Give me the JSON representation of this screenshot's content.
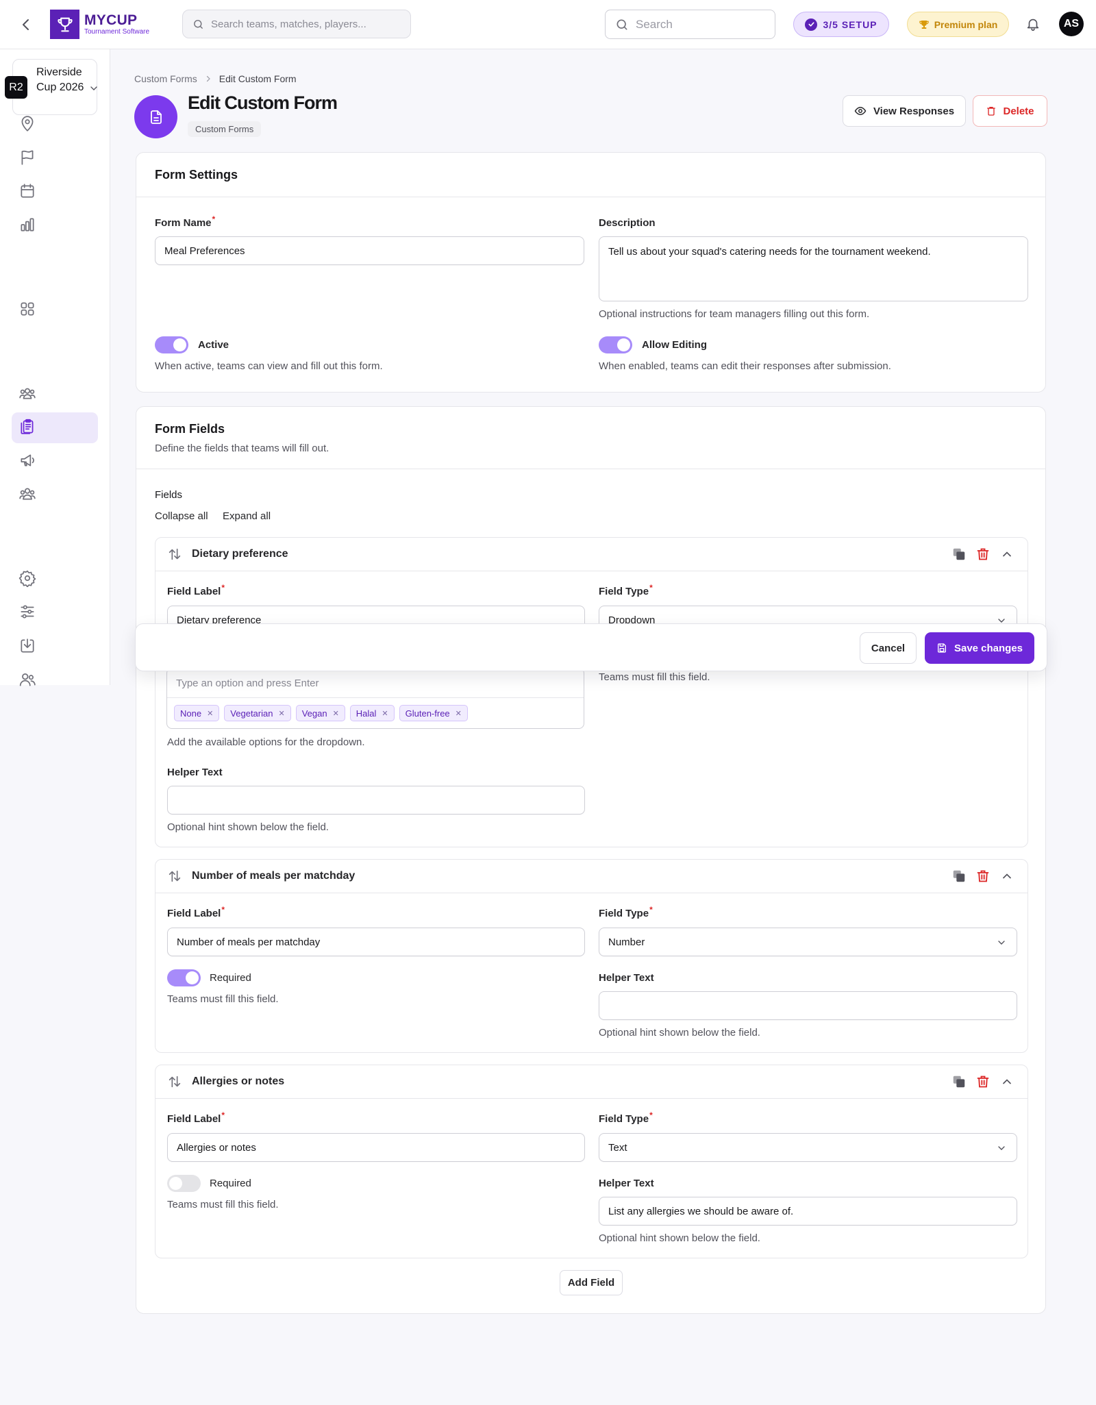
{
  "app": {
    "logo_title": "MYCUP",
    "logo_subtitle": "Tournament Software",
    "search_placeholder": "Search teams, matches, players...",
    "search2_placeholder": "Search",
    "setup_label": "3/5  SETUP",
    "premium_label": "Premium plan",
    "avatar_initials": "AS"
  },
  "sidebar": {
    "tournament_badge": "R2",
    "tournament_name": "Riverside Cup 2026",
    "items": [
      {
        "icon": "map-pin-icon"
      },
      {
        "icon": "flag-icon"
      },
      {
        "icon": "calendar-icon"
      },
      {
        "icon": "bar-chart-icon"
      },
      {
        "icon": "grid-icon"
      },
      {
        "icon": "teams-icon"
      },
      {
        "icon": "clipboard-icon",
        "active": true
      },
      {
        "icon": "megaphone-icon"
      },
      {
        "icon": "users-group-icon"
      },
      {
        "icon": "settings-icon"
      },
      {
        "icon": "sliders-icon"
      },
      {
        "icon": "download-icon"
      },
      {
        "icon": "user-icon"
      }
    ]
  },
  "breadcrumb": {
    "parent": "Custom Forms",
    "current": "Edit Custom Form"
  },
  "page": {
    "title": "Edit Custom Form",
    "tag": "Custom Forms",
    "view_responses": "View Responses",
    "delete": "Delete"
  },
  "form_settings": {
    "title": "Form Settings",
    "name_label": "Form Name",
    "name_value": "Meal Preferences",
    "description_label": "Description",
    "description_value": "Tell us about your squad's catering needs for the tournament weekend.",
    "description_help": "Optional instructions for team managers filling out this form.",
    "active_label": "Active",
    "active_help": "When active, teams can view and fill out this form.",
    "active_on": true,
    "editing_label": "Allow Editing",
    "editing_help": "When enabled, teams can edit their responses after submission.",
    "editing_on": true
  },
  "form_fields": {
    "title": "Form Fields",
    "subtitle": "Define the fields that teams will fill out.",
    "fields_label": "Fields",
    "collapse_all": "Collapse all",
    "expand_all": "Expand all",
    "add_field": "Add Field",
    "items": [
      {
        "title": "Dietary preference",
        "label_caption": "Field Label",
        "label_value": "Dietary preference",
        "type_caption": "Field Type",
        "type_value": "Dropdown",
        "options_placeholder": "Type an option and press Enter",
        "options": [
          "None",
          "Vegetarian",
          "Vegan",
          "Halal",
          "Gluten-free"
        ],
        "options_help": "Add the available options for the dropdown.",
        "required_help": "Teams must fill this field.",
        "helper_caption": "Helper Text",
        "helper_value": "",
        "helper_help": "Optional hint shown below the field."
      },
      {
        "title": "Number of meals per matchday",
        "label_caption": "Field Label",
        "label_value": "Number of meals per matchday",
        "type_caption": "Field Type",
        "type_value": "Number",
        "required_label": "Required",
        "required_on": true,
        "required_help": "Teams must fill this field.",
        "helper_caption": "Helper Text",
        "helper_value": "",
        "helper_help": "Optional hint shown below the field."
      },
      {
        "title": "Allergies or notes",
        "label_caption": "Field Label",
        "label_value": "Allergies or notes",
        "type_caption": "Field Type",
        "type_value": "Text",
        "required_label": "Required",
        "required_on": false,
        "required_help": "Teams must fill this field.",
        "helper_caption": "Helper Text",
        "helper_value": "List any allergies we should be aware of.",
        "helper_help": "Optional hint shown below the field."
      }
    ]
  },
  "action_bar": {
    "cancel": "Cancel",
    "save": "Save changes"
  },
  "colors": {
    "brand": "#6d28d9",
    "danger": "#dc2626",
    "toggle_on": "#a78bfa",
    "premium": "#c2860a"
  }
}
